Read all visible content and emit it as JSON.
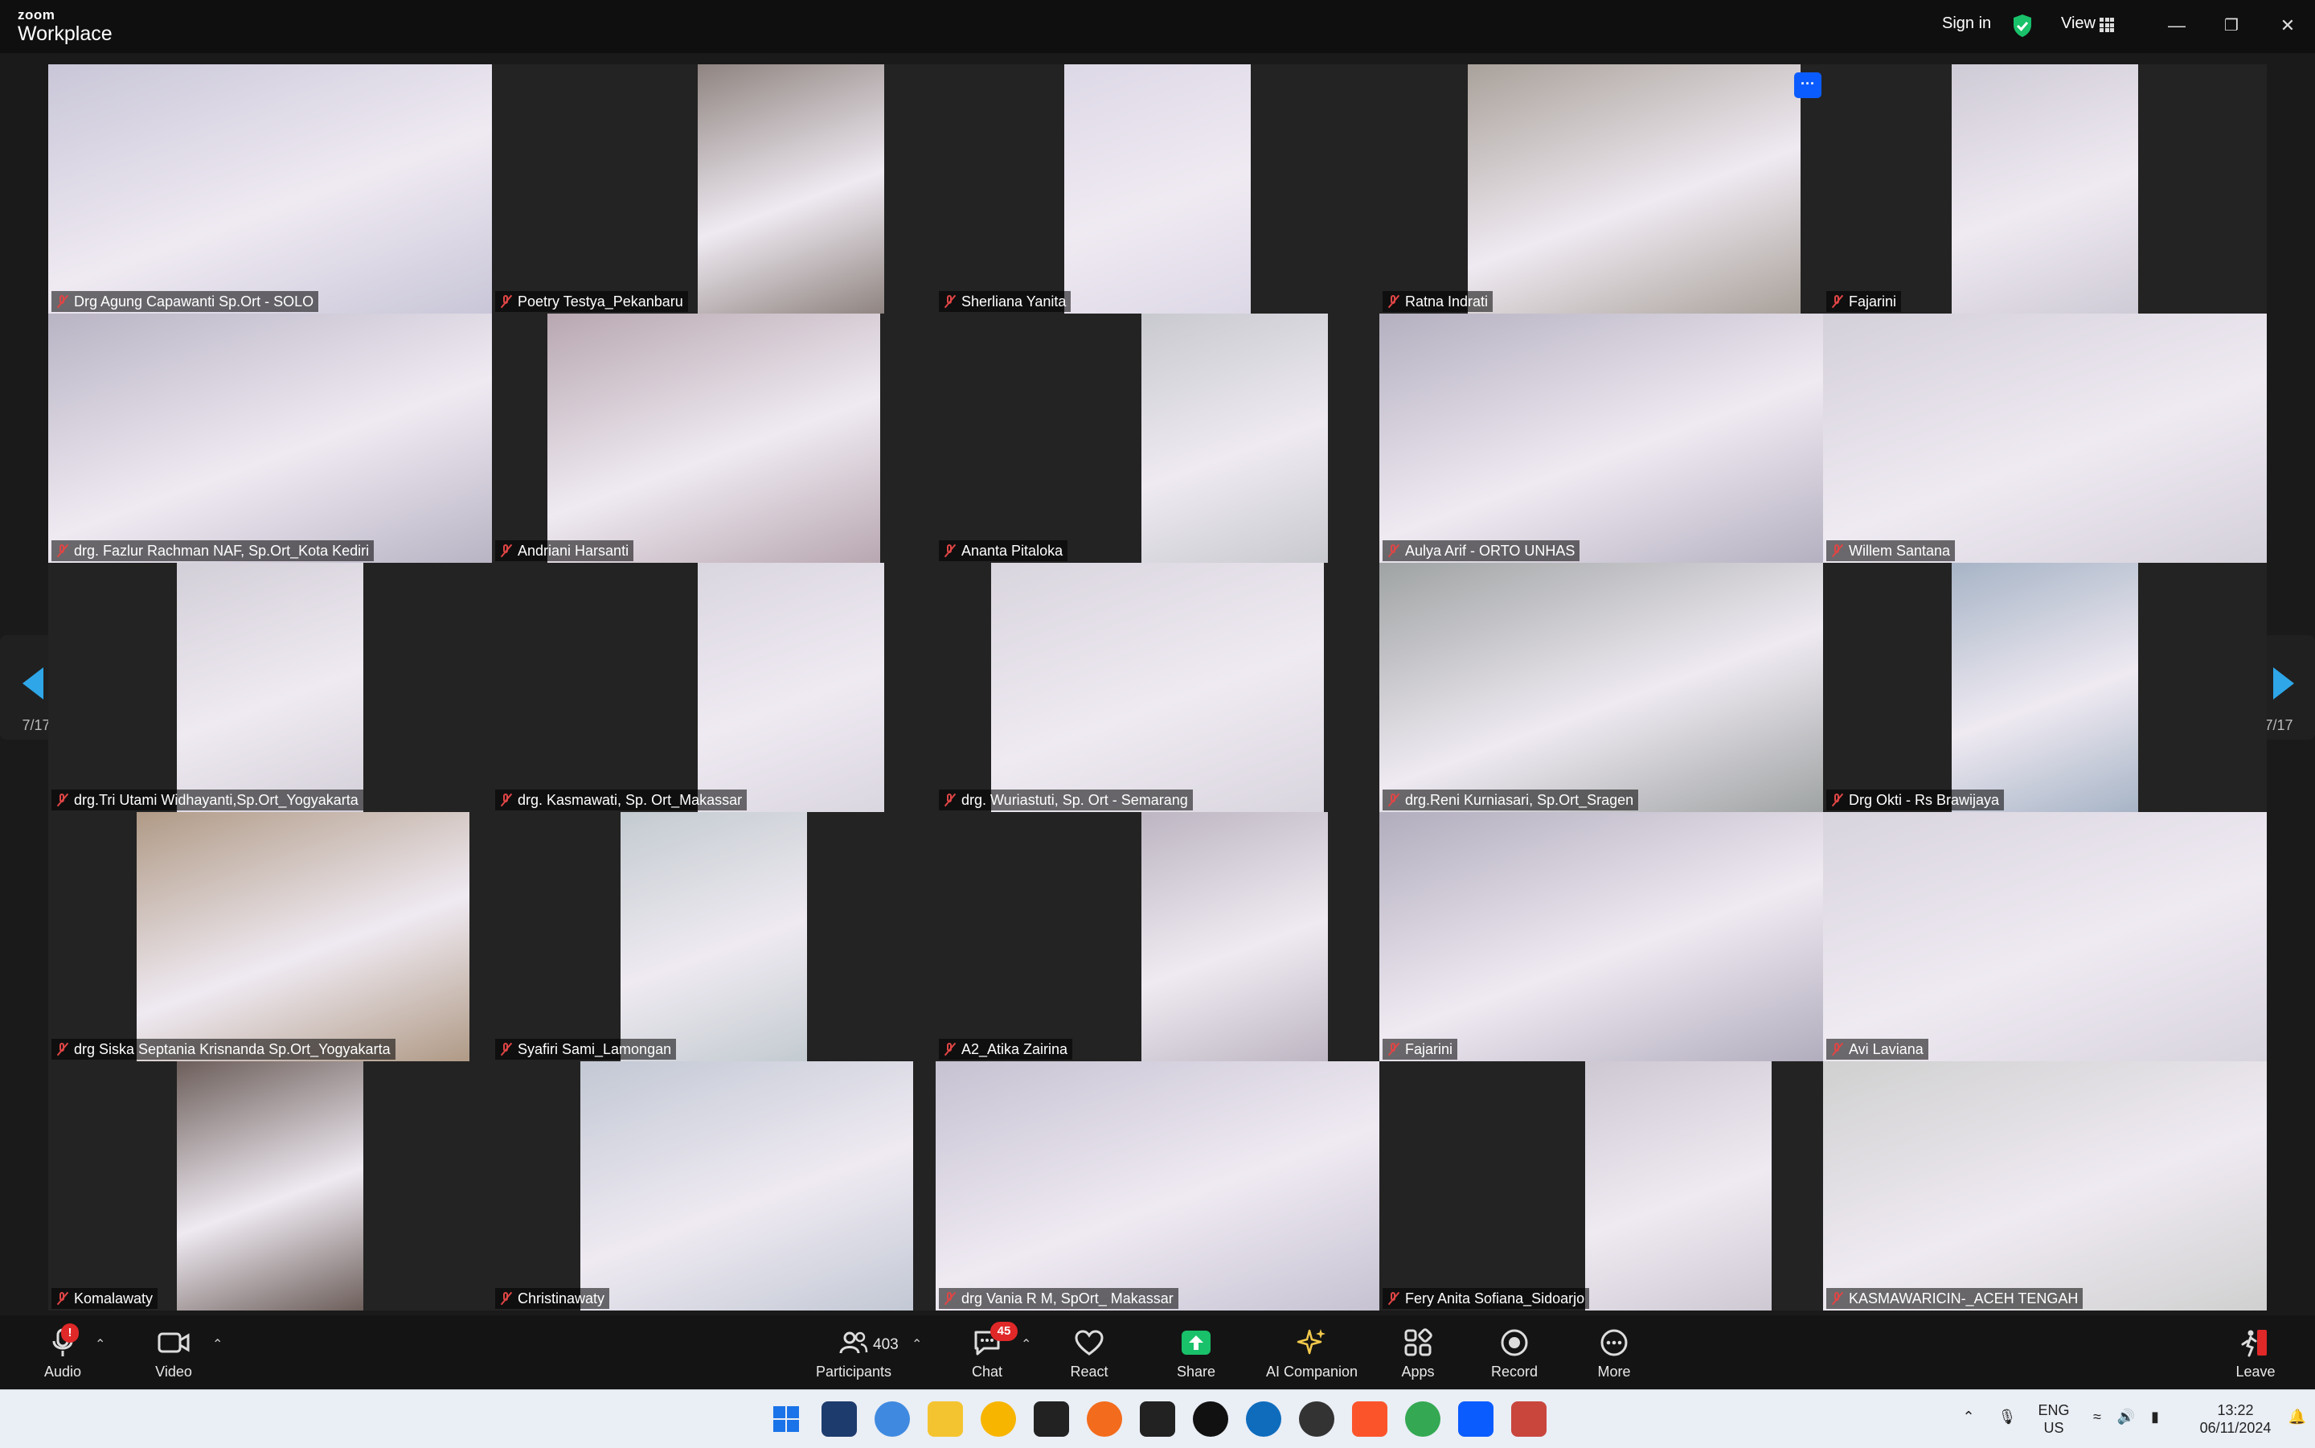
{
  "app": {
    "brand_top": "zoom",
    "brand_bottom": "Workplace",
    "sign_in": "Sign in",
    "view": "View"
  },
  "gallery": {
    "page_left": "7/17",
    "page_right": "7/17",
    "more_badge": "···",
    "tiles": [
      {
        "name": "Drg Agung Capawanti Sp.Ort - SOLO",
        "bg": "#c9c6d8",
        "wide": true
      },
      {
        "name": "Poetry Testya_Pekanbaru",
        "bg": "#8f8480",
        "wide": false
      },
      {
        "name": "Sherliana Yanita",
        "bg": "#ddd8e6",
        "wide": false
      },
      {
        "name": "Ratna Indrati",
        "bg": "#a9a19a",
        "wide": false
      },
      {
        "name": "Fajarini",
        "bg": "#cfcbd6",
        "wide": false
      },
      {
        "name": "drg. Fazlur Rachman NAF, Sp.Ort_Kota Kediri",
        "bg": "#b9b4c4",
        "wide": true
      },
      {
        "name": "Andriani Harsanti",
        "bg": "#b8a7b0",
        "wide": false
      },
      {
        "name": "Ananta Pitaloka",
        "bg": "#c8c9cf",
        "wide": false
      },
      {
        "name": "Aulya Arif - ORTO UNHAS",
        "bg": "#b5b0c0",
        "wide": true
      },
      {
        "name": "Willem Santana",
        "bg": "#d4d0da",
        "wide": true
      },
      {
        "name": "drg.Tri Utami Widhayanti,Sp.Ort_Yogyakarta",
        "bg": "#d3cfd8",
        "wide": false
      },
      {
        "name": "drg. Kasmawati, Sp. Ort_Makassar",
        "bg": "#dad6e0",
        "wide": false
      },
      {
        "name": "drg. Wuriastuti, Sp. Ort - Semarang",
        "bg": "#d9d5de",
        "wide": false
      },
      {
        "name": "drg.Reni Kurniasari, Sp.Ort_Sragen",
        "bg": "#9fa3a3",
        "wide": true
      },
      {
        "name": "Drg Okti - Rs Brawijaya",
        "bg": "#a7b4c6",
        "wide": false
      },
      {
        "name": "drg Siska Septania Krisnanda Sp.Ort_Yogyakarta",
        "bg": "#b09a86",
        "wide": false
      },
      {
        "name": "Syafiri Sami_Lamongan",
        "bg": "#c3cbd0",
        "wide": false
      },
      {
        "name": "A2_Atika Zairina",
        "bg": "#bdb6c2",
        "wide": false
      },
      {
        "name": "Fajarini",
        "bg": "#b2adbd",
        "wide": true
      },
      {
        "name": "Avi Laviana",
        "bg": "#d8d4de",
        "wide": true
      },
      {
        "name": "Komalawaty",
        "bg": "#6c5e5a",
        "wide": false
      },
      {
        "name": "Christinawaty",
        "bg": "#c2c8d4",
        "wide": false
      },
      {
        "name": "drg Vania R M, SpOrt_ Makassar",
        "bg": "#c6c2d2",
        "wide": true
      },
      {
        "name": "Fery Anita Sofiana_Sidoarjo",
        "bg": "#cdc8d2",
        "wide": false
      },
      {
        "name": "KASMAWARICIN-_ACEH TENGAH",
        "bg": "#d0d0d0",
        "wide": true
      }
    ]
  },
  "toolbar": {
    "audio": "Audio",
    "audio_badge": "!",
    "video": "Video",
    "participants": "Participants",
    "participants_count": "403",
    "chat": "Chat",
    "chat_badge": "45",
    "react": "React",
    "share": "Share",
    "ai_companion": "AI Companion",
    "apps": "Apps",
    "record": "Record",
    "more": "More",
    "leave": "Leave"
  },
  "taskbar": {
    "lang_top": "ENG",
    "lang_bottom": "US",
    "time": "13:22",
    "date": "06/11/2024"
  },
  "colors": {
    "accent": "#0b5cff",
    "share_green": "#19c16a",
    "alert_red": "#e02828",
    "arrow_blue": "#2ea6e8"
  }
}
